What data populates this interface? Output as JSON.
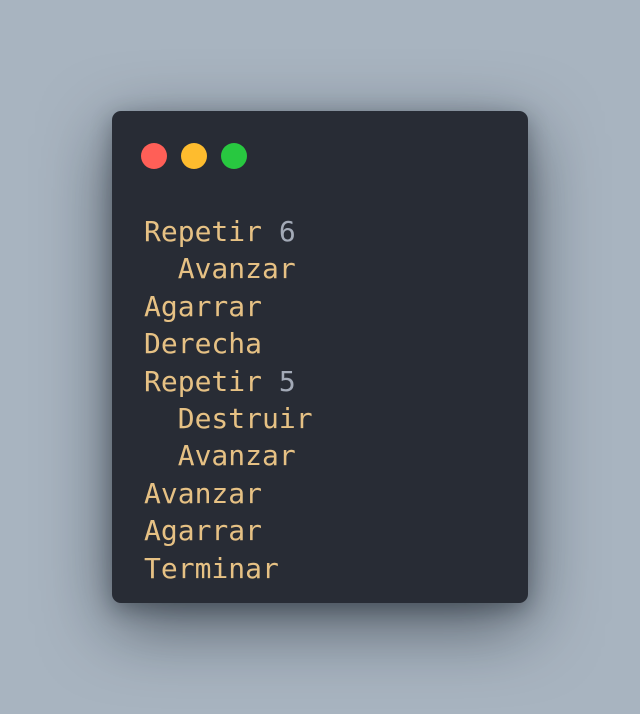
{
  "window": {
    "controls": [
      {
        "name": "close",
        "color": "#ff5f57"
      },
      {
        "name": "minimize",
        "color": "#febc2e"
      },
      {
        "name": "zoom",
        "color": "#28c840"
      }
    ]
  },
  "code": {
    "lines": [
      {
        "indent": "",
        "keyword": "Repetir",
        "number": "6"
      },
      {
        "indent": "  ",
        "keyword": "Avanzar",
        "number": ""
      },
      {
        "indent": "",
        "keyword": "Agarrar",
        "number": ""
      },
      {
        "indent": "",
        "keyword": "Derecha",
        "number": ""
      },
      {
        "indent": "",
        "keyword": "Repetir",
        "number": "5"
      },
      {
        "indent": "  ",
        "keyword": "Destruir",
        "number": ""
      },
      {
        "indent": "  ",
        "keyword": "Avanzar",
        "number": ""
      },
      {
        "indent": "",
        "keyword": "Avanzar",
        "number": ""
      },
      {
        "indent": "",
        "keyword": "Agarrar",
        "number": ""
      },
      {
        "indent": "",
        "keyword": "Terminar",
        "number": ""
      }
    ]
  }
}
